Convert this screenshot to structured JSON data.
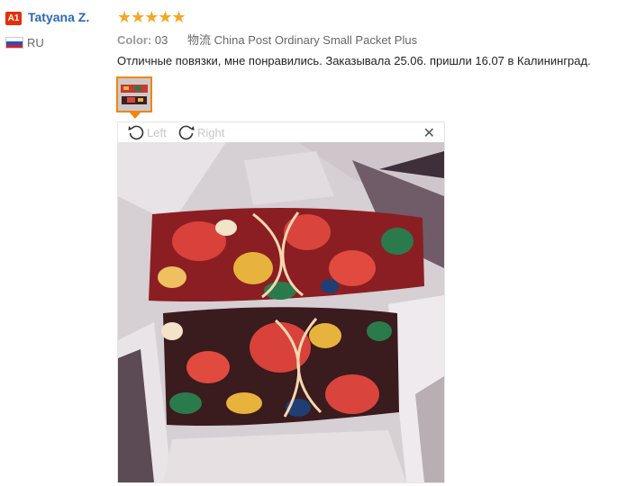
{
  "user": {
    "badge": "A1",
    "name": "Tatyana Z.",
    "country": "RU"
  },
  "review": {
    "stars": "★★★★★",
    "color_label": "Color:",
    "color_value": "03",
    "shipping_icon": "物流",
    "shipping_value": "China Post Ordinary Small Packet Plus",
    "text": "Отличные повязки, мне понравились. Заказывала 25.06. пришли 16.07 в Калининград."
  },
  "viewer": {
    "rotate_left": "Left",
    "rotate_right": "Right",
    "close": "✕"
  },
  "icons": {
    "rotate_left": "rotate-left-icon",
    "rotate_right": "rotate-right-icon",
    "close": "close-icon",
    "flag": "russia-flag-icon"
  },
  "colors": {
    "accent": "#f2850d",
    "link": "#2a69b8",
    "star": "#f5a623",
    "badge": "#e62e04"
  }
}
